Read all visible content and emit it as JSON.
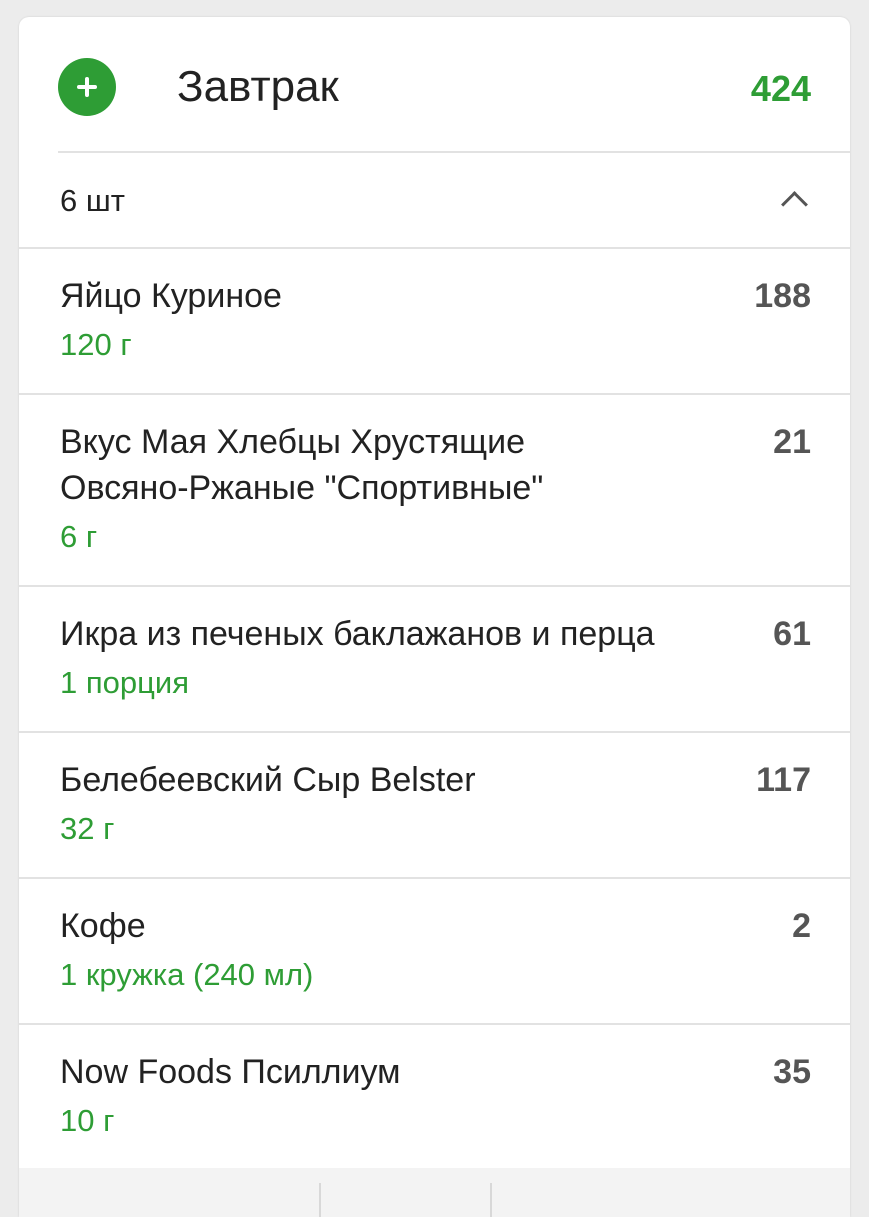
{
  "meal": {
    "title": "Завтрак",
    "total_calories": "424",
    "add_icon": "plus-circle-icon",
    "accent_color": "#2e9d35"
  },
  "summary": {
    "count_label": "6 шт",
    "toggle_icon": "chevron-up-icon"
  },
  "items": [
    {
      "name": "Яйцо Куриное",
      "quantity": "120 г",
      "calories": "188"
    },
    {
      "name": "Вкус Мая Хлебцы Хрустящие Овсяно-Ржаные \"Спортивные\"",
      "quantity": "6 г",
      "calories": "21"
    },
    {
      "name": "Икра из печеных баклажанов и перца",
      "quantity": "1 порция",
      "calories": "61"
    },
    {
      "name": "Белебеевский Сыр Belster",
      "quantity": "32 г",
      "calories": "117"
    },
    {
      "name": "Кофе",
      "quantity": "1 кружка (240 мл)",
      "calories": "2"
    },
    {
      "name": "Now Foods Псиллиум",
      "quantity": "10 г",
      "calories": "35"
    }
  ]
}
